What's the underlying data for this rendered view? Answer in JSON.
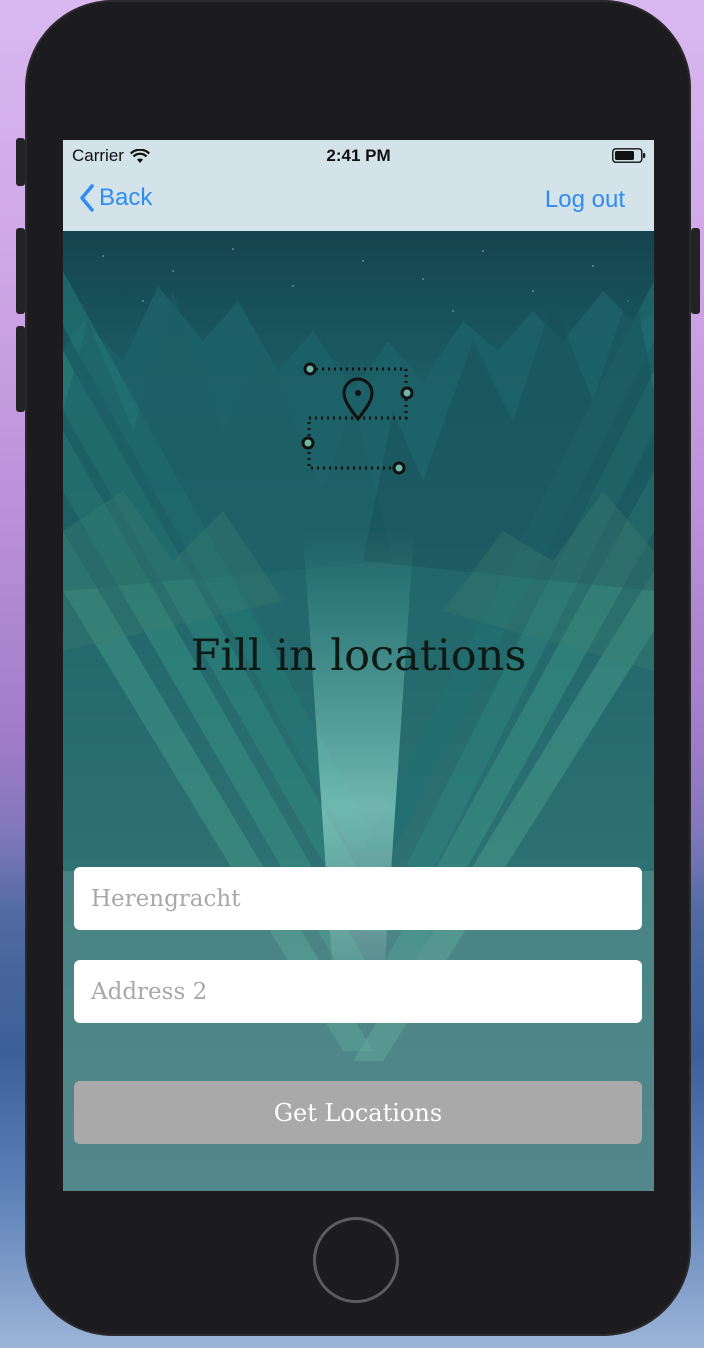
{
  "status_bar": {
    "carrier": "Carrier",
    "time": "2:41 PM"
  },
  "nav": {
    "back_label": "Back",
    "logout_label": "Log out"
  },
  "main": {
    "headline": "Fill in locations",
    "address1_placeholder": "Herengracht",
    "address2_placeholder": "Address 2",
    "submit_label": "Get Locations"
  },
  "colors": {
    "accent": "#2f8cf0",
    "button_disabled": "#a9a9a9",
    "phone_body": "#1c1c1e"
  },
  "icons": [
    "wifi-icon",
    "battery-icon",
    "chevron-left-icon",
    "route-location-icon",
    "home-button"
  ]
}
